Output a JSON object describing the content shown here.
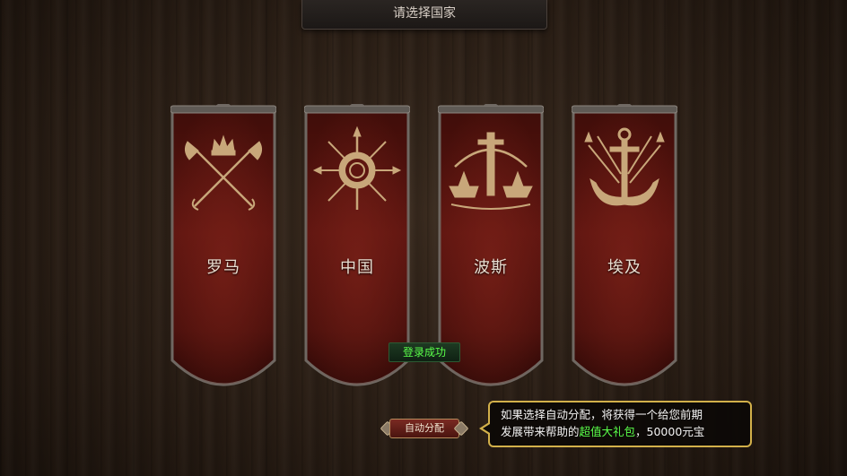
{
  "header": {
    "title": "请选择国家"
  },
  "countries": [
    {
      "name": "罗马",
      "emblem": "crossed-axes-crown-icon"
    },
    {
      "name": "中国",
      "emblem": "shield-spears-icon"
    },
    {
      "name": "波斯",
      "emblem": "ships-sword-icon"
    },
    {
      "name": "埃及",
      "emblem": "anchor-tridents-icon"
    }
  ],
  "status": {
    "login_success": "登录成功"
  },
  "auto_assign": {
    "label": "自动分配"
  },
  "tooltip": {
    "line1": "如果选择自动分配，将获得一个给您前期",
    "line2_prefix": "发展带来帮助的",
    "line2_highlight": "超值大礼包",
    "line2_suffix": "，50000元宝"
  },
  "colors": {
    "banner_red": "#5e1510",
    "banner_highlight": "#7d2219",
    "emblem_tan": "#c8a77a",
    "success_green": "#5aff4a",
    "tooltip_border": "#d2b04a"
  }
}
